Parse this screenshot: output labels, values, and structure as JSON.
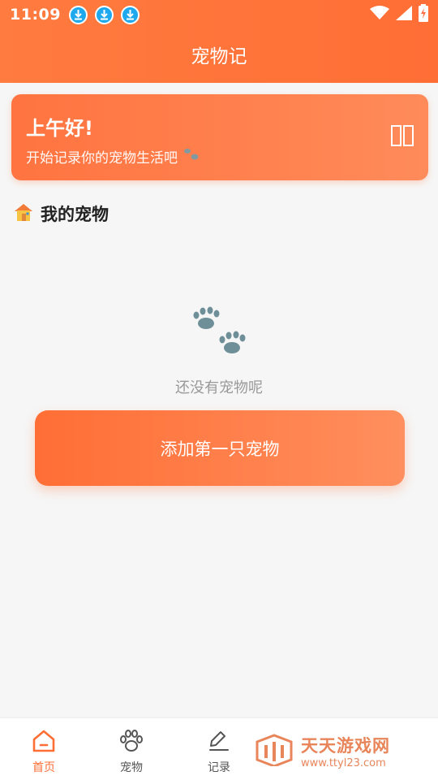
{
  "status_bar": {
    "time": "11:09",
    "notification_icons": [
      "download-icon",
      "download-icon",
      "download-icon"
    ],
    "system_icons": [
      "wifi-icon",
      "signal-icon",
      "battery-charging-icon"
    ]
  },
  "app_bar": {
    "title": "宠物记"
  },
  "greeting_card": {
    "title": "上午好!",
    "subtitle": "开始记录你的宠物生活吧",
    "subtitle_icon": "paw-icon",
    "right_icon": "missing-glyph-icon"
  },
  "section": {
    "icon": "house-icon",
    "title": "我的宠物"
  },
  "empty_state": {
    "icon": "paw-prints-icon",
    "message": "还没有宠物呢",
    "button_label": "添加第一只宠物"
  },
  "bottom_nav": {
    "items": [
      {
        "label": "首页",
        "icon": "home-icon",
        "active": true
      },
      {
        "label": "宠物",
        "icon": "paw-icon",
        "active": false
      },
      {
        "label": "记录",
        "icon": "pen-icon",
        "active": false
      }
    ]
  },
  "watermark": {
    "name": "天天游戏网",
    "url": "www.ttyl23.com"
  },
  "colors": {
    "accent": "#ff6e35",
    "background": "#f6f6f6",
    "muted_text": "#999999",
    "paw": "#6e8f98"
  }
}
